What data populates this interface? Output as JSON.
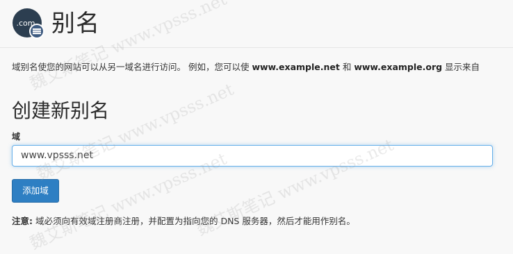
{
  "header": {
    "logo_text": ".com",
    "title": "别名"
  },
  "description": {
    "part1": "域别名使您的网站可以从另一域名进行访问。 例如，您可以使 ",
    "domain1": "www.example.net",
    "and": " 和 ",
    "domain2": "www.example.org",
    "part2": " 显示来自"
  },
  "create": {
    "heading": "创建新别名",
    "domain_label": "域",
    "domain_value": "www.vpsss.net",
    "add_button": "添加域"
  },
  "note": {
    "label": "注意:",
    "text": " 域必须向有效域注册商注册，并配置为指向您的 DNS 服务器，然后才能用作别名。"
  },
  "watermark": {
    "text": "魏艾斯笔记 www.vpsss.net"
  },
  "colors": {
    "button": "#2e7fc3",
    "input_focus_border": "#66afe9",
    "logo_bg": "#2c3e50"
  }
}
